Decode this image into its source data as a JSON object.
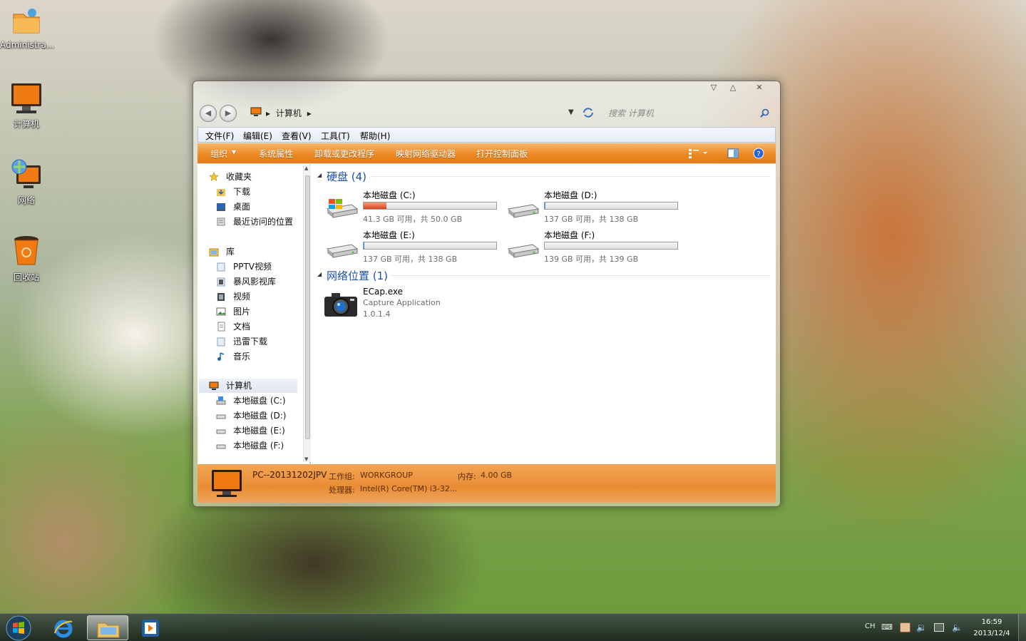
{
  "desktop": {
    "icons": [
      {
        "id": "administrator",
        "label": "Administra..."
      },
      {
        "id": "computer",
        "label": "计算机"
      },
      {
        "id": "network",
        "label": "网络"
      },
      {
        "id": "recycle",
        "label": "回收站"
      }
    ]
  },
  "window": {
    "controls": {
      "minimize": "▽",
      "maximize": "△",
      "close": "✕"
    },
    "address": {
      "crumb": "计算机",
      "sep": "▸"
    },
    "search": {
      "placeholder": "搜索 计算机"
    },
    "menu": [
      "文件(F)",
      "编辑(E)",
      "查看(V)",
      "工具(T)",
      "帮助(H)"
    ],
    "toolbar": {
      "organize": "组织",
      "sys_props": "系统属性",
      "uninstall": "卸载或更改程序",
      "map_drive": "映射网络驱动器",
      "control_panel": "打开控制面板"
    },
    "nav": {
      "favorites": {
        "title": "收藏夹",
        "items": [
          "下载",
          "桌面",
          "最近访问的位置"
        ]
      },
      "libraries": {
        "title": "库",
        "items": [
          "PPTV视频",
          "暴风影视库",
          "视频",
          "图片",
          "文档",
          "迅雷下载",
          "音乐"
        ]
      },
      "computer": {
        "title": "计算机",
        "items": [
          "本地磁盘 (C:)",
          "本地磁盘 (D:)",
          "本地磁盘 (E:)",
          "本地磁盘 (F:)"
        ]
      }
    },
    "groups": {
      "disks": "硬盘 (4)",
      "network": "网络位置 (1)"
    },
    "drives": [
      {
        "name": "本地磁盘 (C:)",
        "free": "41.3 GB 可用，共 50.0 GB",
        "used_fraction": 0.17,
        "bar_color": "#d8431c"
      },
      {
        "name": "本地磁盘 (D:)",
        "free": "137 GB 可用，共 138 GB",
        "used_fraction": 0.007,
        "bar_color": "#3a8ee6"
      },
      {
        "name": "本地磁盘 (E:)",
        "free": "137 GB 可用，共 138 GB",
        "used_fraction": 0.007,
        "bar_color": "#3a8ee6"
      },
      {
        "name": "本地磁盘 (F:)",
        "free": "139 GB 可用，共 139 GB",
        "used_fraction": 0.0,
        "bar_color": "#3a8ee6"
      }
    ],
    "network_item": {
      "name": "ECap.exe",
      "desc": "Capture Application",
      "version": "1.0.1.4"
    },
    "details": {
      "pc": "PC--20131202JPV",
      "wg_label": "工作组:",
      "wg": "WORKGROUP",
      "mem_label": "内存:",
      "mem": "4.00 GB",
      "cpu_label": "处理器:",
      "cpu": "Intel(R) Core(TM) i3-32..."
    }
  },
  "taskbar": {
    "lang": "CH",
    "time": "16:59",
    "date": "2013/12/4"
  }
}
